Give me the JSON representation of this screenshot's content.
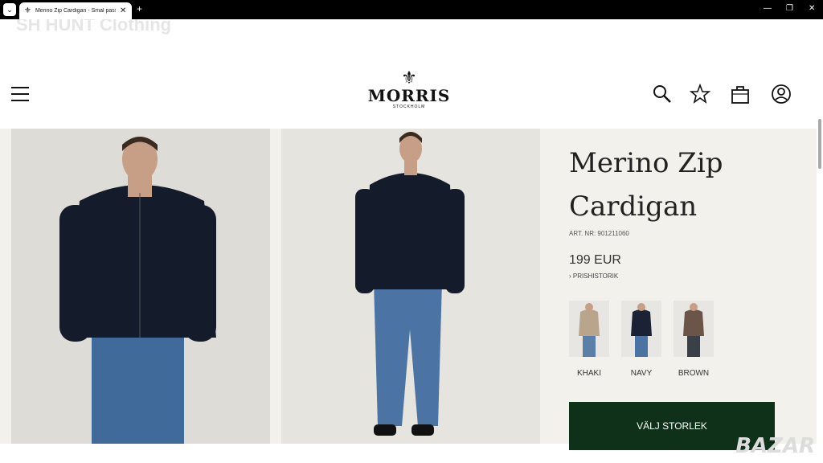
{
  "browser": {
    "tab_title": "Merino Zip Cardigan - Smal passform",
    "new_tab_symbol": "+",
    "close_symbol": "✕"
  },
  "page": {
    "watermark_top": "SH HUNT Clothing",
    "watermark_bottom": "BAZAR"
  },
  "header": {
    "logo_name": "MORRIS",
    "logo_sub": "STOCKHOLM",
    "icons": [
      "menu-icon",
      "search-icon",
      "star-icon",
      "bag-icon",
      "user-icon"
    ]
  },
  "product": {
    "title_line1": "Merino Zip",
    "title_line2": "Cardigan",
    "article": "ART. NR: 901211060",
    "price": "199 EUR",
    "price_history": "› PRISHISTORIK",
    "colors": [
      {
        "label": "KHAKI",
        "sweater": "#b8a58c",
        "jeans": "#5b7fa6"
      },
      {
        "label": "NAVY",
        "sweater": "#1a2233",
        "jeans": "#4c74a3"
      },
      {
        "label": "BROWN",
        "sweater": "#6b5548",
        "jeans": "#3a3f48"
      }
    ],
    "select_size": "VÄLJ STORLEK"
  },
  "colors": {
    "button": "#0f3019",
    "background": "#f3f1ec"
  }
}
